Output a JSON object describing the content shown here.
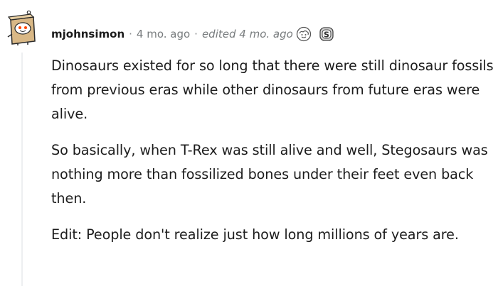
{
  "comment": {
    "author": "mjohnsimon",
    "separator": "·",
    "age": "4 mo. ago",
    "edited": "edited 4 mo. ago",
    "awards": [
      {
        "icon": "wholesome-award-icon"
      },
      {
        "icon": "silver-s-award-icon"
      }
    ],
    "paragraphs": [
      "Dinosaurs existed for so long that there were still dinosaur fossils from previous eras while other dinosaurs from future eras were alive.",
      "So basically, when T-Rex was still alive and well, Stegosaurs was nothing more than fossilized bones under their feet even back then.",
      "Edit: People don't realize just how long millions of years are."
    ]
  },
  "colors": {
    "text": "#1c1c1c",
    "meta": "#787c7e",
    "thread_line": "#edeff1",
    "avatar_box": "#d9b886",
    "avatar_face": "#ff4500"
  }
}
